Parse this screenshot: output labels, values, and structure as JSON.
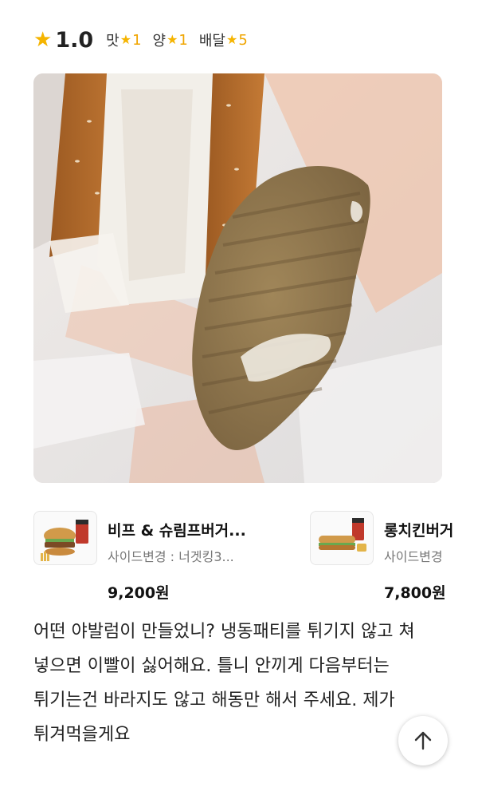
{
  "rating": {
    "overall": "1.0",
    "categories": [
      {
        "label": "맛",
        "value": "1"
      },
      {
        "label": "양",
        "value": "1"
      },
      {
        "label": "배달",
        "value": "5"
      }
    ]
  },
  "photo": {
    "icon": "review-photo-burger-patty"
  },
  "menu_items": [
    {
      "name": "비프 & 슈림프버거...",
      "side": "사이드변경 : 너겟킹3...",
      "price": "9,200원",
      "icon": "burger-set-icon"
    },
    {
      "name": "롱치킨버거",
      "side": "사이드변경",
      "price": "7,800원",
      "icon": "long-chicken-burger-icon"
    }
  ],
  "review": {
    "text": "어떤 야발럼이 만들었니? 냉동패티를 튀기지 않고 쳐 넣으면 이빨이 싫어해요. 틀니 안끼게 다음부터는 튀기는건 바라지도 않고 해동만 해서 주세요. 제가 튀겨먹을게요"
  },
  "colors": {
    "star": "#f5b400",
    "rating_value": "#f0a500"
  },
  "scroll_top": {
    "icon": "arrow-up-icon"
  }
}
